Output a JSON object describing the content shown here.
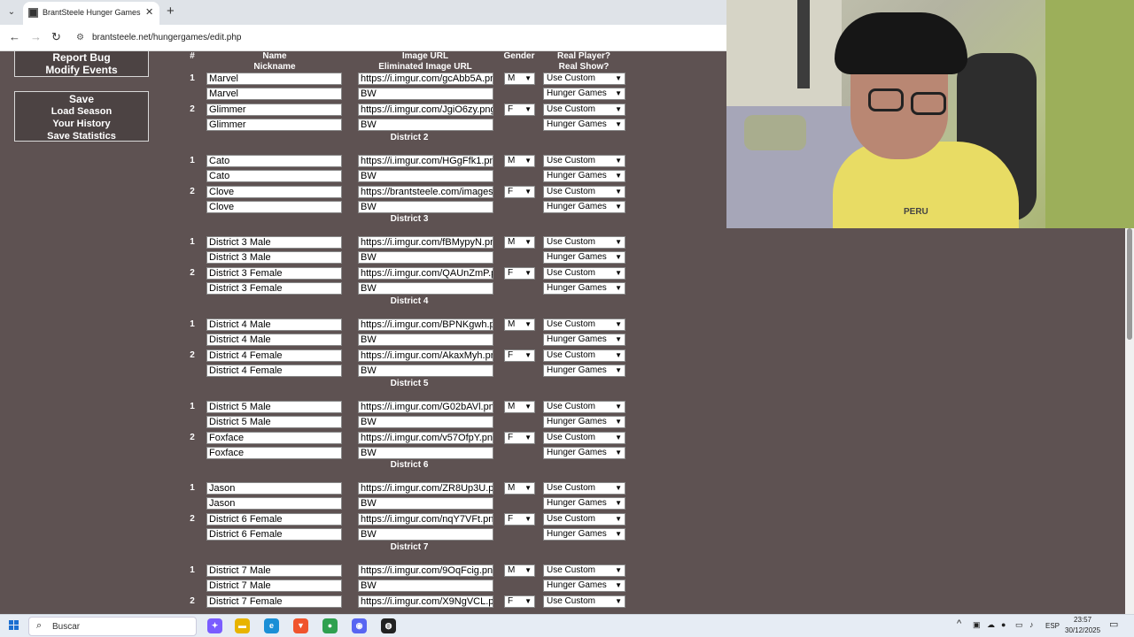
{
  "browser": {
    "tab_title": "BrantSteele Hunger Games Sim",
    "url": "brantsteele.net/hungergames/edit.php"
  },
  "menu": {
    "top": [
      "Report Bug",
      "Modify Events"
    ],
    "bottom": [
      "Save",
      "Load Season",
      "Your History",
      "Save Statistics"
    ]
  },
  "table": {
    "headers": {
      "num": "#",
      "name": "Name",
      "nickname": "Nickname",
      "image_url": "Image URL",
      "elim_url": "Eliminated Image URL",
      "gender": "Gender",
      "real_player": "Real Player?",
      "real_show": "Real Show?"
    },
    "districts": [
      {
        "title": "",
        "tributes": [
          {
            "num": "1",
            "name": "Marvel",
            "nickname": "Marvel",
            "image_url": "https://i.imgur.com/gcAbb5A.pn",
            "elim_url": "BW",
            "gender": "M",
            "real_player": "Use Custom",
            "real_show": "Hunger Games"
          },
          {
            "num": "2",
            "name": "Glimmer",
            "nickname": "Glimmer",
            "image_url": "https://i.imgur.com/JgiO6zy.png",
            "elim_url": "BW",
            "gender": "F",
            "real_player": "Use Custom",
            "real_show": "Hunger Games"
          }
        ]
      },
      {
        "title": "District 2",
        "tributes": [
          {
            "num": "1",
            "name": "Cato",
            "nickname": "Cato",
            "image_url": "https://i.imgur.com/HGgFfk1.pn",
            "elim_url": "BW",
            "gender": "M",
            "real_player": "Use Custom",
            "real_show": "Hunger Games"
          },
          {
            "num": "2",
            "name": "Clove",
            "nickname": "Clove",
            "image_url": "https://brantsteele.com/images",
            "elim_url": "BW",
            "gender": "F",
            "real_player": "Use Custom",
            "real_show": "Hunger Games"
          }
        ]
      },
      {
        "title": "District 3",
        "tributes": [
          {
            "num": "1",
            "name": "District 3 Male",
            "nickname": "District 3 Male",
            "image_url": "https://i.imgur.com/fBMypyN.pn",
            "elim_url": "BW",
            "gender": "M",
            "real_player": "Use Custom",
            "real_show": "Hunger Games"
          },
          {
            "num": "2",
            "name": "District 3 Female",
            "nickname": "District 3 Female",
            "image_url": "https://i.imgur.com/QAUnZmP.p",
            "elim_url": "BW",
            "gender": "F",
            "real_player": "Use Custom",
            "real_show": "Hunger Games"
          }
        ]
      },
      {
        "title": "District 4",
        "tributes": [
          {
            "num": "1",
            "name": "District 4 Male",
            "nickname": "District 4 Male",
            "image_url": "https://i.imgur.com/BPNKgwh.p",
            "elim_url": "BW",
            "gender": "M",
            "real_player": "Use Custom",
            "real_show": "Hunger Games"
          },
          {
            "num": "2",
            "name": "District 4 Female",
            "nickname": "District 4 Female",
            "image_url": "https://i.imgur.com/AkaxMyh.pn",
            "elim_url": "BW",
            "gender": "F",
            "real_player": "Use Custom",
            "real_show": "Hunger Games"
          }
        ]
      },
      {
        "title": "District 5",
        "tributes": [
          {
            "num": "1",
            "name": "District 5 Male",
            "nickname": "District 5 Male",
            "image_url": "https://i.imgur.com/G02bAVl.pn",
            "elim_url": "BW",
            "gender": "M",
            "real_player": "Use Custom",
            "real_show": "Hunger Games"
          },
          {
            "num": "2",
            "name": "Foxface",
            "nickname": "Foxface",
            "image_url": "https://i.imgur.com/v57OfpY.pn",
            "elim_url": "BW",
            "gender": "F",
            "real_player": "Use Custom",
            "real_show": "Hunger Games"
          }
        ]
      },
      {
        "title": "District 6",
        "tributes": [
          {
            "num": "1",
            "name": "Jason",
            "nickname": "Jason",
            "image_url": "https://i.imgur.com/ZR8Up3U.p",
            "elim_url": "BW",
            "gender": "M",
            "real_player": "Use Custom",
            "real_show": "Hunger Games"
          },
          {
            "num": "2",
            "name": "District 6 Female",
            "nickname": "District 6 Female",
            "image_url": "https://i.imgur.com/nqY7VFt.pn",
            "elim_url": "BW",
            "gender": "F",
            "real_player": "Use Custom",
            "real_show": "Hunger Games"
          }
        ]
      },
      {
        "title": "District 7",
        "tributes": [
          {
            "num": "1",
            "name": "District 7 Male",
            "nickname": "District 7 Male",
            "image_url": "https://i.imgur.com/9OqFcig.pn",
            "elim_url": "BW",
            "gender": "M",
            "real_player": "Use Custom",
            "real_show": "Hunger Games"
          },
          {
            "num": "2",
            "name": "District 7 Female",
            "nickname": "",
            "image_url": "https://i.imgur.com/X9NgVCL.p",
            "elim_url": "",
            "gender": "F",
            "real_player": "Use Custom",
            "real_show": ""
          }
        ]
      }
    ]
  },
  "webcam": {
    "shirt_text": "PERU"
  },
  "taskbar": {
    "search_placeholder": "Buscar",
    "language": "ESP",
    "time": "23:57",
    "date": "30/12/2025",
    "apps": [
      {
        "name": "copilot",
        "glyph": "✦",
        "color": "#7a5cff"
      },
      {
        "name": "file-explorer",
        "glyph": "▬",
        "color": "#e8b400"
      },
      {
        "name": "edge",
        "glyph": "e",
        "color": "#1a8fd6"
      },
      {
        "name": "brave",
        "glyph": "▼",
        "color": "#f0542d"
      },
      {
        "name": "chrome",
        "glyph": "●",
        "color": "#2ea04f"
      },
      {
        "name": "discord",
        "glyph": "◉",
        "color": "#5865f2"
      },
      {
        "name": "media-app",
        "glyph": "◍",
        "color": "#222222"
      }
    ]
  }
}
